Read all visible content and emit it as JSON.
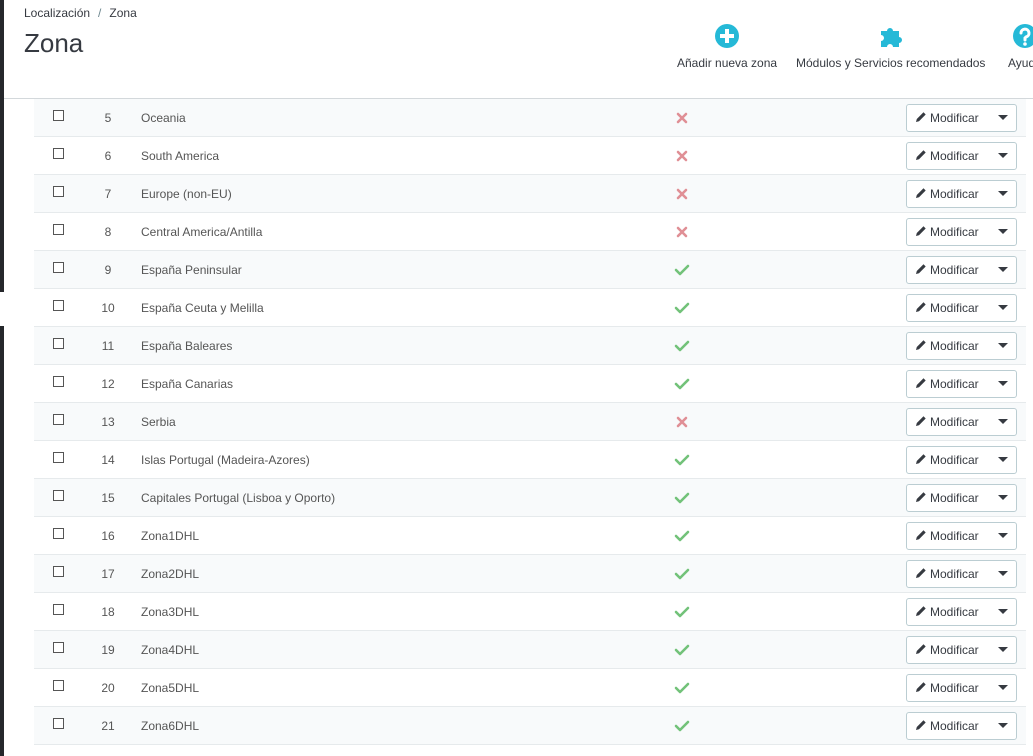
{
  "breadcrumb": {
    "parent": "Localización",
    "separator": "/",
    "current": "Zona"
  },
  "page_title": "Zona",
  "toolbar": {
    "add_label": "Añadir nueva zona",
    "modules_label": "Módulos y Servicios recomendados",
    "help_label": "Ayuda"
  },
  "colors": {
    "accent": "#25b9d7",
    "enabled": "#72c279",
    "disabled": "#e08f95"
  },
  "rows": [
    {
      "id": "5",
      "name": "Oceania",
      "active": false,
      "action": "Modificar"
    },
    {
      "id": "6",
      "name": "South America",
      "active": false,
      "action": "Modificar"
    },
    {
      "id": "7",
      "name": "Europe (non-EU)",
      "active": false,
      "action": "Modificar"
    },
    {
      "id": "8",
      "name": "Central America/Antilla",
      "active": false,
      "action": "Modificar"
    },
    {
      "id": "9",
      "name": "España Peninsular",
      "active": true,
      "action": "Modificar"
    },
    {
      "id": "10",
      "name": "España Ceuta y Melilla",
      "active": true,
      "action": "Modificar"
    },
    {
      "id": "11",
      "name": "España Baleares",
      "active": true,
      "action": "Modificar"
    },
    {
      "id": "12",
      "name": "España Canarias",
      "active": true,
      "action": "Modificar"
    },
    {
      "id": "13",
      "name": "Serbia",
      "active": false,
      "action": "Modificar"
    },
    {
      "id": "14",
      "name": "Islas Portugal (Madeira-Azores)",
      "active": true,
      "action": "Modificar"
    },
    {
      "id": "15",
      "name": "Capitales Portugal (Lisboa y Oporto)",
      "active": true,
      "action": "Modificar"
    },
    {
      "id": "16",
      "name": "Zona1DHL",
      "active": true,
      "action": "Modificar"
    },
    {
      "id": "17",
      "name": "Zona2DHL",
      "active": true,
      "action": "Modificar"
    },
    {
      "id": "18",
      "name": "Zona3DHL",
      "active": true,
      "action": "Modificar"
    },
    {
      "id": "19",
      "name": "Zona4DHL",
      "active": true,
      "action": "Modificar"
    },
    {
      "id": "20",
      "name": "Zona5DHL",
      "active": true,
      "action": "Modificar"
    },
    {
      "id": "21",
      "name": "Zona6DHL",
      "active": true,
      "action": "Modificar"
    }
  ]
}
